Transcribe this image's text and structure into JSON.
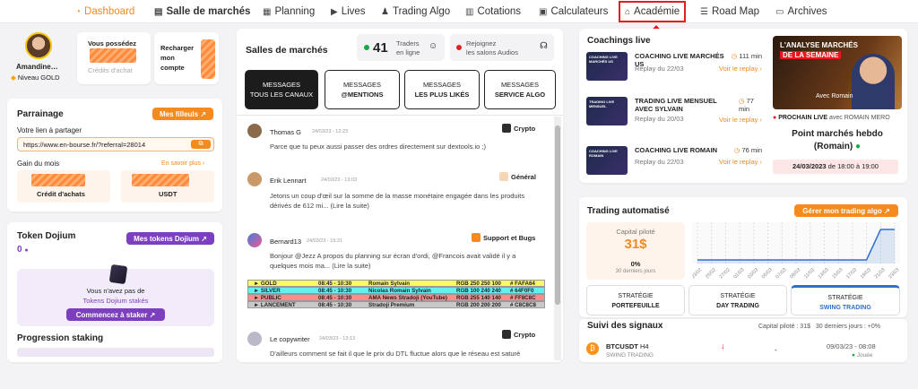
{
  "nav": {
    "items": [
      {
        "label": "Dashboard",
        "icon": "gauge-icon"
      },
      {
        "label": "Salle de marchés",
        "icon": "chat-icon"
      },
      {
        "label": "Planning",
        "icon": "calendar-icon"
      },
      {
        "label": "Lives",
        "icon": "play-icon"
      },
      {
        "label": "Trading Algo",
        "icon": "robot-icon"
      },
      {
        "label": "Cotations",
        "icon": "chart-icon"
      },
      {
        "label": "Calculateurs",
        "icon": "calculator-icon"
      },
      {
        "label": "Académie",
        "icon": "graduation-icon"
      },
      {
        "label": "Road Map",
        "icon": "list-icon"
      },
      {
        "label": "Archives",
        "icon": "archive-icon"
      }
    ]
  },
  "profile": {
    "name": "Amandine…",
    "level": "Niveau GOLD"
  },
  "credits": {
    "title": "Vous possédez",
    "caption": "Crédits d'achat"
  },
  "recharge": {
    "label": "Recharger mon compte"
  },
  "parrainage": {
    "title": "Parrainage",
    "button": "Mes filleuls",
    "link_label": "Votre lien à partager",
    "link_value": "https://www.en-bourse.fr/?referral=28014",
    "gain_label": "Gain du mois",
    "more": "En savoir plus",
    "credit_caption": "Crédit d'achats",
    "usdt_caption": "USDT"
  },
  "token": {
    "title": "Token Dojium",
    "button": "Mes tokens Dojium",
    "count": "0",
    "empty_line1": "Vous n'avez pas de",
    "empty_line2": "Tokens Dojium stakés",
    "stake_button": "Commencez à staker"
  },
  "staking": {
    "title": "Progression staking"
  },
  "salles": {
    "title": "Salles de marchés",
    "traders_count": "41",
    "traders_label_1": "Traders",
    "traders_label_2": "en ligne",
    "audio_1": "Rejoignez",
    "audio_2": "les salons Audios",
    "tabs": [
      {
        "l1": "MESSAGES",
        "l2": "TOUS LES CANAUX"
      },
      {
        "l1": "MESSAGES",
        "l2": "@MENTIONS"
      },
      {
        "l1": "MESSAGES",
        "l2": "LES PLUS LIKÉS"
      },
      {
        "l1": "MESSAGES",
        "l2": "SERVICE ALGO"
      }
    ],
    "messages": [
      {
        "author": "Thomas G",
        "date": "24/03/23 - 12:23",
        "channel": "Crypto",
        "text": "Parce que tu peux aussi passer des ordres directement sur dextools.io ;)"
      },
      {
        "author": "Erik Lennart",
        "date": "24/03/23 - 13:03",
        "channel": "Général",
        "text": "Jetons un coup d'œil sur la somme de la masse monétaire engagée dans les produits dérivés de 612 mi... (Lire la suite)"
      },
      {
        "author": "Bernard13",
        "date": "24/03/23 - 15:21",
        "channel": "Support et Bugs",
        "text": "Bonjour @Jezz A propos du planning sur écran d'ordi, @Francois avait validé il y a quelques mois ma... (Lire la suite)"
      },
      {
        "author": "Le copywriter",
        "date": "24/03/23 - 13:13",
        "channel": "Crypto",
        "text": "D'ailleurs comment se fait il que le prix du DTL fluctue alors que le réseau est saturé"
      }
    ],
    "schedule": [
      {
        "name": "► GOLD",
        "time": "08:45 - 10:30",
        "who": "Romain Sylvain",
        "rgb": "RGB 250 250 100",
        "hex": "# FAFA64",
        "color": "#fafa64"
      },
      {
        "name": "► SILVER",
        "time": "08:45 - 10:30",
        "who": "Nicolas Romain Sylvain",
        "rgb": "RGB 100 240 240",
        "hex": "# 64F0F0",
        "color": "#64f0f0"
      },
      {
        "name": "► PUBLIC",
        "time": "08:45 - 10:30",
        "who": "AMA News Stradoji (YouTube)",
        "rgb": "RGB 255 140 140",
        "hex": "# FF8C8C",
        "color": "#ff8c8c"
      },
      {
        "name": "► LANCEMENT",
        "time": "08:45 - 10:30",
        "who": "Stradoji Premium",
        "rgb": "RGB 200 200 200",
        "hex": "# C8C8C8",
        "color": "#c8c8c8"
      }
    ]
  },
  "coachings": {
    "title": "Coachings live",
    "items": [
      {
        "thumb": "COACHING LIVE MARCHÉS US",
        "title": "COACHING LIVE MARCHÉS US",
        "date": "Replay du 22/03",
        "dur": "111 min",
        "replay": "Voir le replay"
      },
      {
        "thumb": "TRADING LIVE MENSUEL",
        "title": "TRADING LIVE MENSUEL AVEC SYLVAIN",
        "date": "Replay du 20/03",
        "dur": "77 min",
        "replay": "Voir le replay"
      },
      {
        "thumb": "COACHING LIVE ROMAIN",
        "title": "COACHING LIVE ROMAIN",
        "date": "Replay du 22/03",
        "dur": "76 min",
        "replay": "Voir le replay"
      }
    ],
    "feature": {
      "banner_1": "L'ANALYSE MARCHÉS",
      "banner_2": "DE LA SEMAINE",
      "avec": "Avec Romain",
      "next_label": "PROCHAIN LIVE",
      "next_with": "avec ROMAIN MERO",
      "title_1": "Point marchés hebdo",
      "title_2": "(Romain)",
      "date": "24/03/2023",
      "time": "de 18:00 à 19:00"
    }
  },
  "trading": {
    "title": "Trading automatisé",
    "button": "Gérer mon trading algo",
    "capital_label": "Capital piloté",
    "capital_value": "31$",
    "pct": "0%",
    "period": "30 derniers jours",
    "chart_labels": [
      "23/02",
      "25/02",
      "27/02",
      "01/03",
      "03/03",
      "05/03",
      "07/03",
      "09/03",
      "11/03",
      "13/03",
      "15/03",
      "17/03",
      "19/03",
      "21/03",
      "23/03"
    ],
    "strategies": [
      {
        "l1": "STRATÉGIE",
        "l2": "PORTEFEUILLE"
      },
      {
        "l1": "STRATÉGIE",
        "l2": "DAY TRADING"
      },
      {
        "l1": "STRATÉGIE",
        "l2": "SWING TRADING"
      }
    ]
  },
  "signaux": {
    "title": "Suivi des signaux",
    "capital": "Capital piloté : 31$",
    "period": "30 derniers jours : +0%",
    "row": {
      "pair": "BTCUSDT",
      "tf": "H4",
      "type": "SWING TRADING",
      "value": "-",
      "date": "09/03/23 - 08:08",
      "status": "Jouée"
    }
  },
  "chart_data": {
    "type": "area",
    "x": [
      "23/02",
      "25/02",
      "27/02",
      "01/03",
      "03/03",
      "05/03",
      "07/03",
      "09/03",
      "11/03",
      "13/03",
      "15/03",
      "17/03",
      "19/03",
      "21/03",
      "23/03"
    ],
    "series": [
      {
        "values": [
          0,
          0,
          0,
          0,
          0,
          0,
          0,
          0,
          0,
          0,
          0,
          0,
          0,
          1,
          1
        ]
      }
    ]
  }
}
